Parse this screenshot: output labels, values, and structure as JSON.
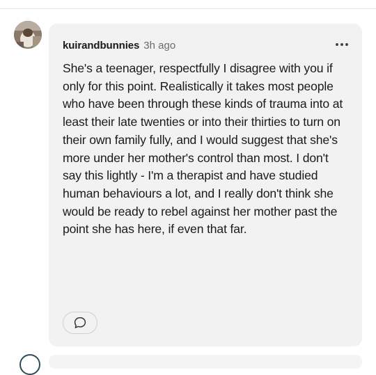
{
  "comment": {
    "author": "kuirandbunnies",
    "timestamp": "3h ago",
    "body": "She's a teenager, respectfully I disagree with you if only for this point. Realistically it takes most people who have been through these kinds of trauma into at least their late twenties or into their thirties to turn on their own family fully, and I would suggest that she's more under her mother's control than most. I don't say this lightly - I'm a therapist and have studied human behaviours a lot, and I really don't think she would be ready to rebel against her mother past the point she has here, if even that far.",
    "more_icon": "more-horizontal-icon",
    "reply_icon": "speech-bubble-icon"
  }
}
